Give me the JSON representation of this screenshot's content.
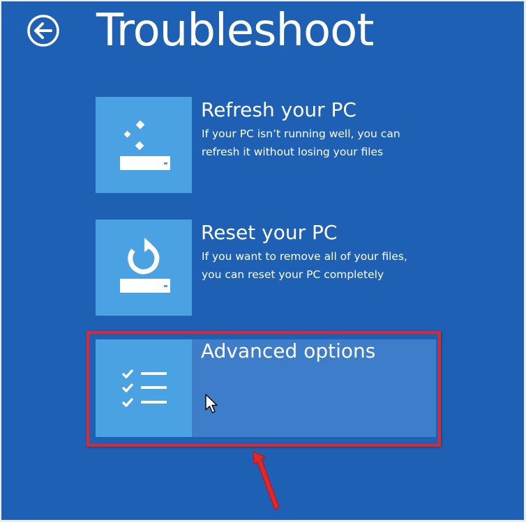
{
  "header": {
    "title": "Troubleshoot",
    "back_icon": "back-arrow-icon"
  },
  "options": [
    {
      "title": "Refresh your PC",
      "description": "If your PC isn’t running well, you can refresh it without losing your files",
      "icon": "refresh-pc-icon"
    },
    {
      "title": "Reset your PC",
      "description": "If you want to remove all of your files, you can reset your PC completely",
      "icon": "reset-pc-icon"
    },
    {
      "title": "Advanced options",
      "description": "",
      "icon": "checklist-icon",
      "state": "hovered"
    }
  ],
  "annotations": {
    "highlight": "red rectangle around Advanced options",
    "pointer": "red arrow pointing up at Advanced options"
  },
  "colors": {
    "background": "#1e61b4",
    "tile_icon": "#4aa2e2",
    "tile_hover": "#3d7dc9",
    "text": "#ffffff",
    "annotation": "#e0282c"
  }
}
